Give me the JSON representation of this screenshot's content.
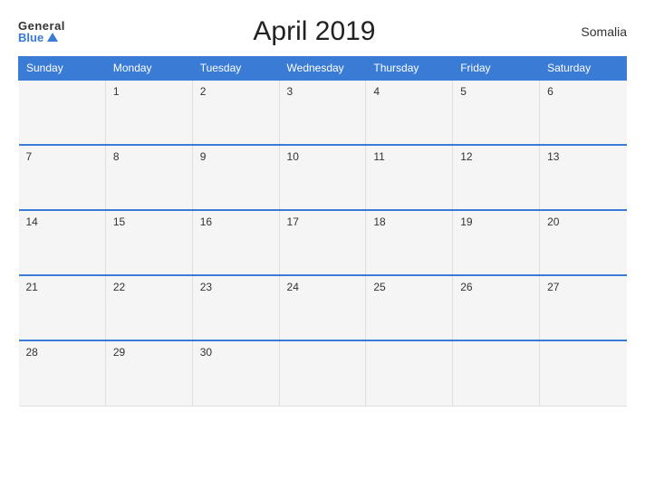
{
  "header": {
    "logo_general": "General",
    "logo_blue": "Blue",
    "title": "April 2019",
    "country": "Somalia"
  },
  "calendar": {
    "days": [
      "Sunday",
      "Monday",
      "Tuesday",
      "Wednesday",
      "Thursday",
      "Friday",
      "Saturday"
    ],
    "weeks": [
      [
        "",
        "1",
        "2",
        "3",
        "4",
        "5",
        "6"
      ],
      [
        "7",
        "8",
        "9",
        "10",
        "11",
        "12",
        "13"
      ],
      [
        "14",
        "15",
        "16",
        "17",
        "18",
        "19",
        "20"
      ],
      [
        "21",
        "22",
        "23",
        "24",
        "25",
        "26",
        "27"
      ],
      [
        "28",
        "29",
        "30",
        "",
        "",
        "",
        ""
      ]
    ]
  }
}
